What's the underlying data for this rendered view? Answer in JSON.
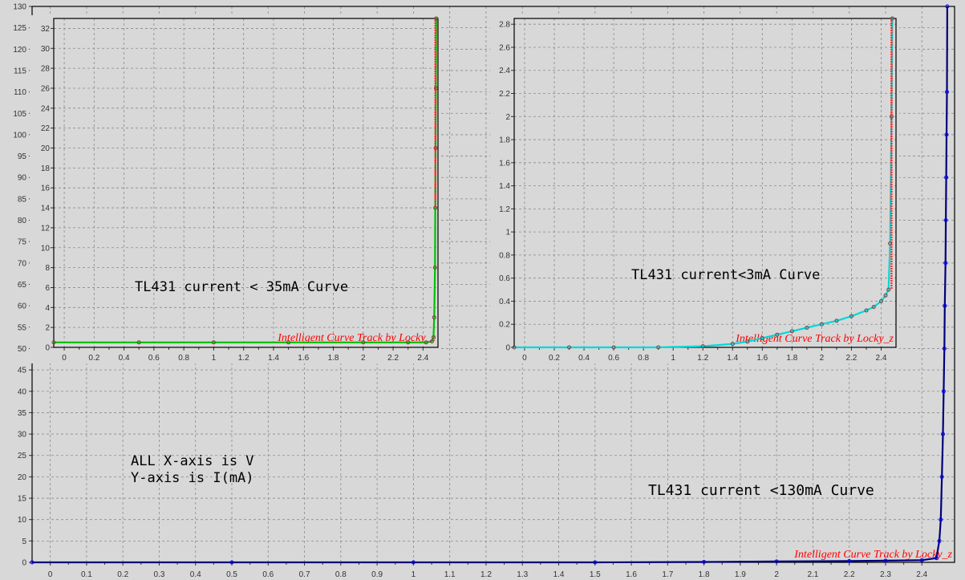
{
  "chart_data": [
    {
      "id": "main",
      "type": "line",
      "xlabel": "",
      "ylabel": "",
      "xlim": [
        -0.05,
        2.49
      ],
      "ylim": [
        0,
        130
      ],
      "xticks": [
        0,
        0.1,
        0.2,
        0.3,
        0.4,
        0.5,
        0.6,
        0.7,
        0.8,
        0.9,
        1,
        1.1,
        1.2,
        1.3,
        1.4,
        1.5,
        1.6,
        1.7,
        1.8,
        1.9,
        2,
        2.1,
        2.2,
        2.3,
        2.4
      ],
      "yticks": [
        0,
        5,
        10,
        15,
        20,
        25,
        30,
        35,
        40,
        45,
        50,
        55,
        60,
        65,
        70,
        75,
        80,
        85,
        90,
        95,
        100,
        105,
        110,
        115,
        120,
        125,
        130
      ],
      "grid": true,
      "series": [
        {
          "color": "#00007a",
          "x": [
            -0.05,
            0.5,
            1.0,
            1.5,
            1.8,
            2.0,
            2.2,
            2.3,
            2.4,
            2.44,
            2.448,
            2.452,
            2.455,
            2.458,
            2.46,
            2.462,
            2.463,
            2.465,
            2.466,
            2.467,
            2.468,
            2.469,
            2.47
          ],
          "y": [
            0,
            0,
            0,
            0,
            0.1,
            0.2,
            0.3,
            0.4,
            0.5,
            1,
            5,
            10,
            20,
            30,
            40,
            50,
            60,
            70,
            80,
            90,
            100,
            110,
            130
          ]
        }
      ],
      "annotations": [
        "TL431 current <130mA Curve",
        "ALL X-axis is V",
        "Y-axis is I(mA)"
      ],
      "watermark": "Intelligent Curve Track by Locky_z"
    },
    {
      "id": "inset-35",
      "type": "line",
      "xlabel": "",
      "ylabel": "",
      "xlim": [
        -0.07,
        2.5
      ],
      "ylim": [
        0,
        33
      ],
      "xticks": [
        0,
        0.2,
        0.4,
        0.6,
        0.8,
        1,
        1.2,
        1.4,
        1.6,
        1.8,
        2,
        2.2,
        2.4
      ],
      "yticks": [
        0,
        2,
        4,
        6,
        8,
        10,
        12,
        14,
        16,
        18,
        20,
        22,
        24,
        26,
        28,
        30,
        32
      ],
      "grid": true,
      "series": [
        {
          "color": "#00c000",
          "x": [
            -0.07,
            0.5,
            1.0,
            1.5,
            2.0,
            2.3,
            2.42,
            2.46,
            2.47,
            2.475,
            2.48,
            2.482,
            2.484,
            2.486,
            2.488
          ],
          "y": [
            0.5,
            0.5,
            0.5,
            0.5,
            0.5,
            0.5,
            0.5,
            0.6,
            1,
            3,
            8,
            14,
            20,
            26,
            33
          ]
        }
      ],
      "annotations": [
        "TL431 current < 35mA Curve"
      ],
      "watermark": "Intelligent Curve Track by Locky_z"
    },
    {
      "id": "inset-3",
      "type": "line",
      "xlabel": "",
      "ylabel": "",
      "xlim": [
        -0.07,
        2.5
      ],
      "ylim": [
        0,
        2.85
      ],
      "xticks": [
        0,
        0.2,
        0.4,
        0.6,
        0.8,
        1,
        1.2,
        1.4,
        1.6,
        1.8,
        2,
        2.2,
        2.4
      ],
      "yticks": [
        0,
        0.2,
        0.4,
        0.6,
        0.8,
        1,
        1.2,
        1.4,
        1.6,
        1.8,
        2,
        2.2,
        2.4,
        2.6,
        2.8
      ],
      "grid": true,
      "series": [
        {
          "color": "#00d8d8",
          "x": [
            -0.07,
            0.3,
            0.6,
            0.9,
            1.2,
            1.4,
            1.5,
            1.6,
            1.7,
            1.8,
            1.9,
            2.0,
            2.1,
            2.2,
            2.3,
            2.35,
            2.4,
            2.43,
            2.45,
            2.46,
            2.47,
            2.475
          ],
          "y": [
            0,
            0,
            0,
            0,
            0.01,
            0.03,
            0.05,
            0.08,
            0.11,
            0.14,
            0.17,
            0.2,
            0.23,
            0.27,
            0.32,
            0.35,
            0.4,
            0.45,
            0.5,
            0.9,
            2.0,
            2.85
          ]
        }
      ],
      "annotations": [
        "TL431 current<3mA Curve"
      ],
      "watermark": "Intelligent Curve Track by Locky_z"
    }
  ]
}
